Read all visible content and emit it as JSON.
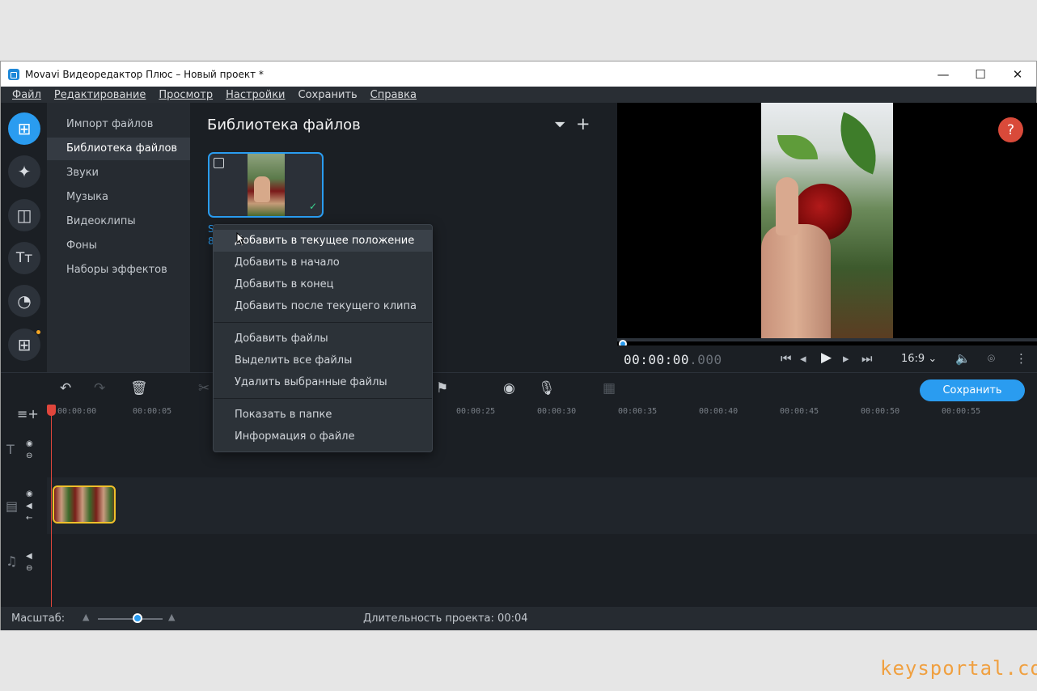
{
  "window": {
    "title": "Movavi Видеоредактор Плюс – Новый проект *",
    "controls": [
      "—",
      "☐",
      "✕"
    ]
  },
  "menu": [
    {
      "label": "Файл"
    },
    {
      "label": "Редактирование"
    },
    {
      "label": "Просмотр"
    },
    {
      "label": "Настройки"
    },
    {
      "label": "Сохранить"
    },
    {
      "label": "Справка"
    }
  ],
  "rail": {
    "buttons": [
      "import-icon",
      "magic-wand-icon",
      "transitions-icon",
      "titles-icon",
      "stickers-icon",
      "more-tools-icon"
    ]
  },
  "categories": [
    {
      "label": "Импорт файлов"
    },
    {
      "label": "Библиотека файлов",
      "selected": true
    },
    {
      "label": "Звуки"
    },
    {
      "label": "Музыка"
    },
    {
      "label": "Видеоклипы"
    },
    {
      "label": "Фоны"
    },
    {
      "label": "Наборы эффектов"
    }
  ],
  "library": {
    "title": "Библиотека файлов",
    "file_name_line1": "S",
    "file_name_line2": "8"
  },
  "preview": {
    "timecode": "00:00:00",
    "timecode_ms": ".000",
    "aspect_ratio": "16:9 ⌄",
    "help": "?"
  },
  "toolbar": {
    "save_label": "Сохранить"
  },
  "ruler": {
    "ticks": [
      "00:00:00",
      "00:00:05",
      "00:00:25",
      "00:00:30",
      "00:00:35",
      "00:00:40",
      "00:00:45",
      "00:00:50",
      "00:00:55"
    ]
  },
  "status": {
    "scale_label": "Масштаб:",
    "duration_label": "Длительность проекта:",
    "duration_value": "00:04",
    "zoom_level": 0.6
  },
  "context_menu": {
    "group1": [
      "Добавить в текущее положение",
      "Добавить в начало",
      "Добавить в конец",
      "Добавить после текущего клипа"
    ],
    "group2": [
      "Добавить файлы",
      "Выделить все файлы",
      "Удалить выбранные файлы"
    ],
    "group3": [
      "Показать в папке",
      "Информация о файле"
    ]
  },
  "watermark": "keysportal.com",
  "colors": {
    "accent": "#2a9cf0",
    "playhead": "#e0463c",
    "clip_border": "#f0c02a",
    "help_button": "#d94a3a"
  }
}
